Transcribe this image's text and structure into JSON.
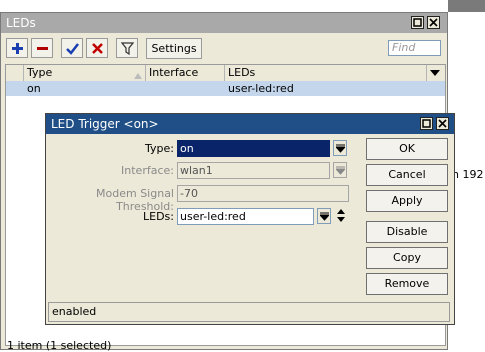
{
  "leds_window": {
    "title": "LEDs",
    "toolbar": {
      "add_icon": "plus-icon",
      "remove_icon": "minus-icon",
      "enable_icon": "check-icon",
      "disable_icon": "x-icon",
      "filter_icon": "filter-icon",
      "settings_label": "Settings",
      "find_placeholder": "Find"
    },
    "columns": [
      "Type",
      "Interface",
      "LEDs"
    ],
    "rows": [
      {
        "type": "on",
        "interface": "",
        "leds": "user-led:red"
      }
    ],
    "status": "1 item (1 selected)"
  },
  "background_fragment": {
    "text": "n 192"
  },
  "dialog": {
    "title": "LED Trigger <on>",
    "fields": {
      "type_label": "Type:",
      "type_value": "on",
      "interface_label": "Interface:",
      "interface_value": "wlan1",
      "modem_label": "Modem Signal Threshold:",
      "modem_value": "-70",
      "leds_label": "LEDs:",
      "leds_value": "user-led:red"
    },
    "buttons": [
      "OK",
      "Cancel",
      "Apply",
      "Disable",
      "Copy",
      "Remove"
    ],
    "status": "enabled"
  },
  "colors": {
    "selection": "#c3d6ec",
    "active_title": "#1f4f86",
    "inactive_title": "#a9a9a9",
    "dialog_selection": "#0a246a"
  }
}
